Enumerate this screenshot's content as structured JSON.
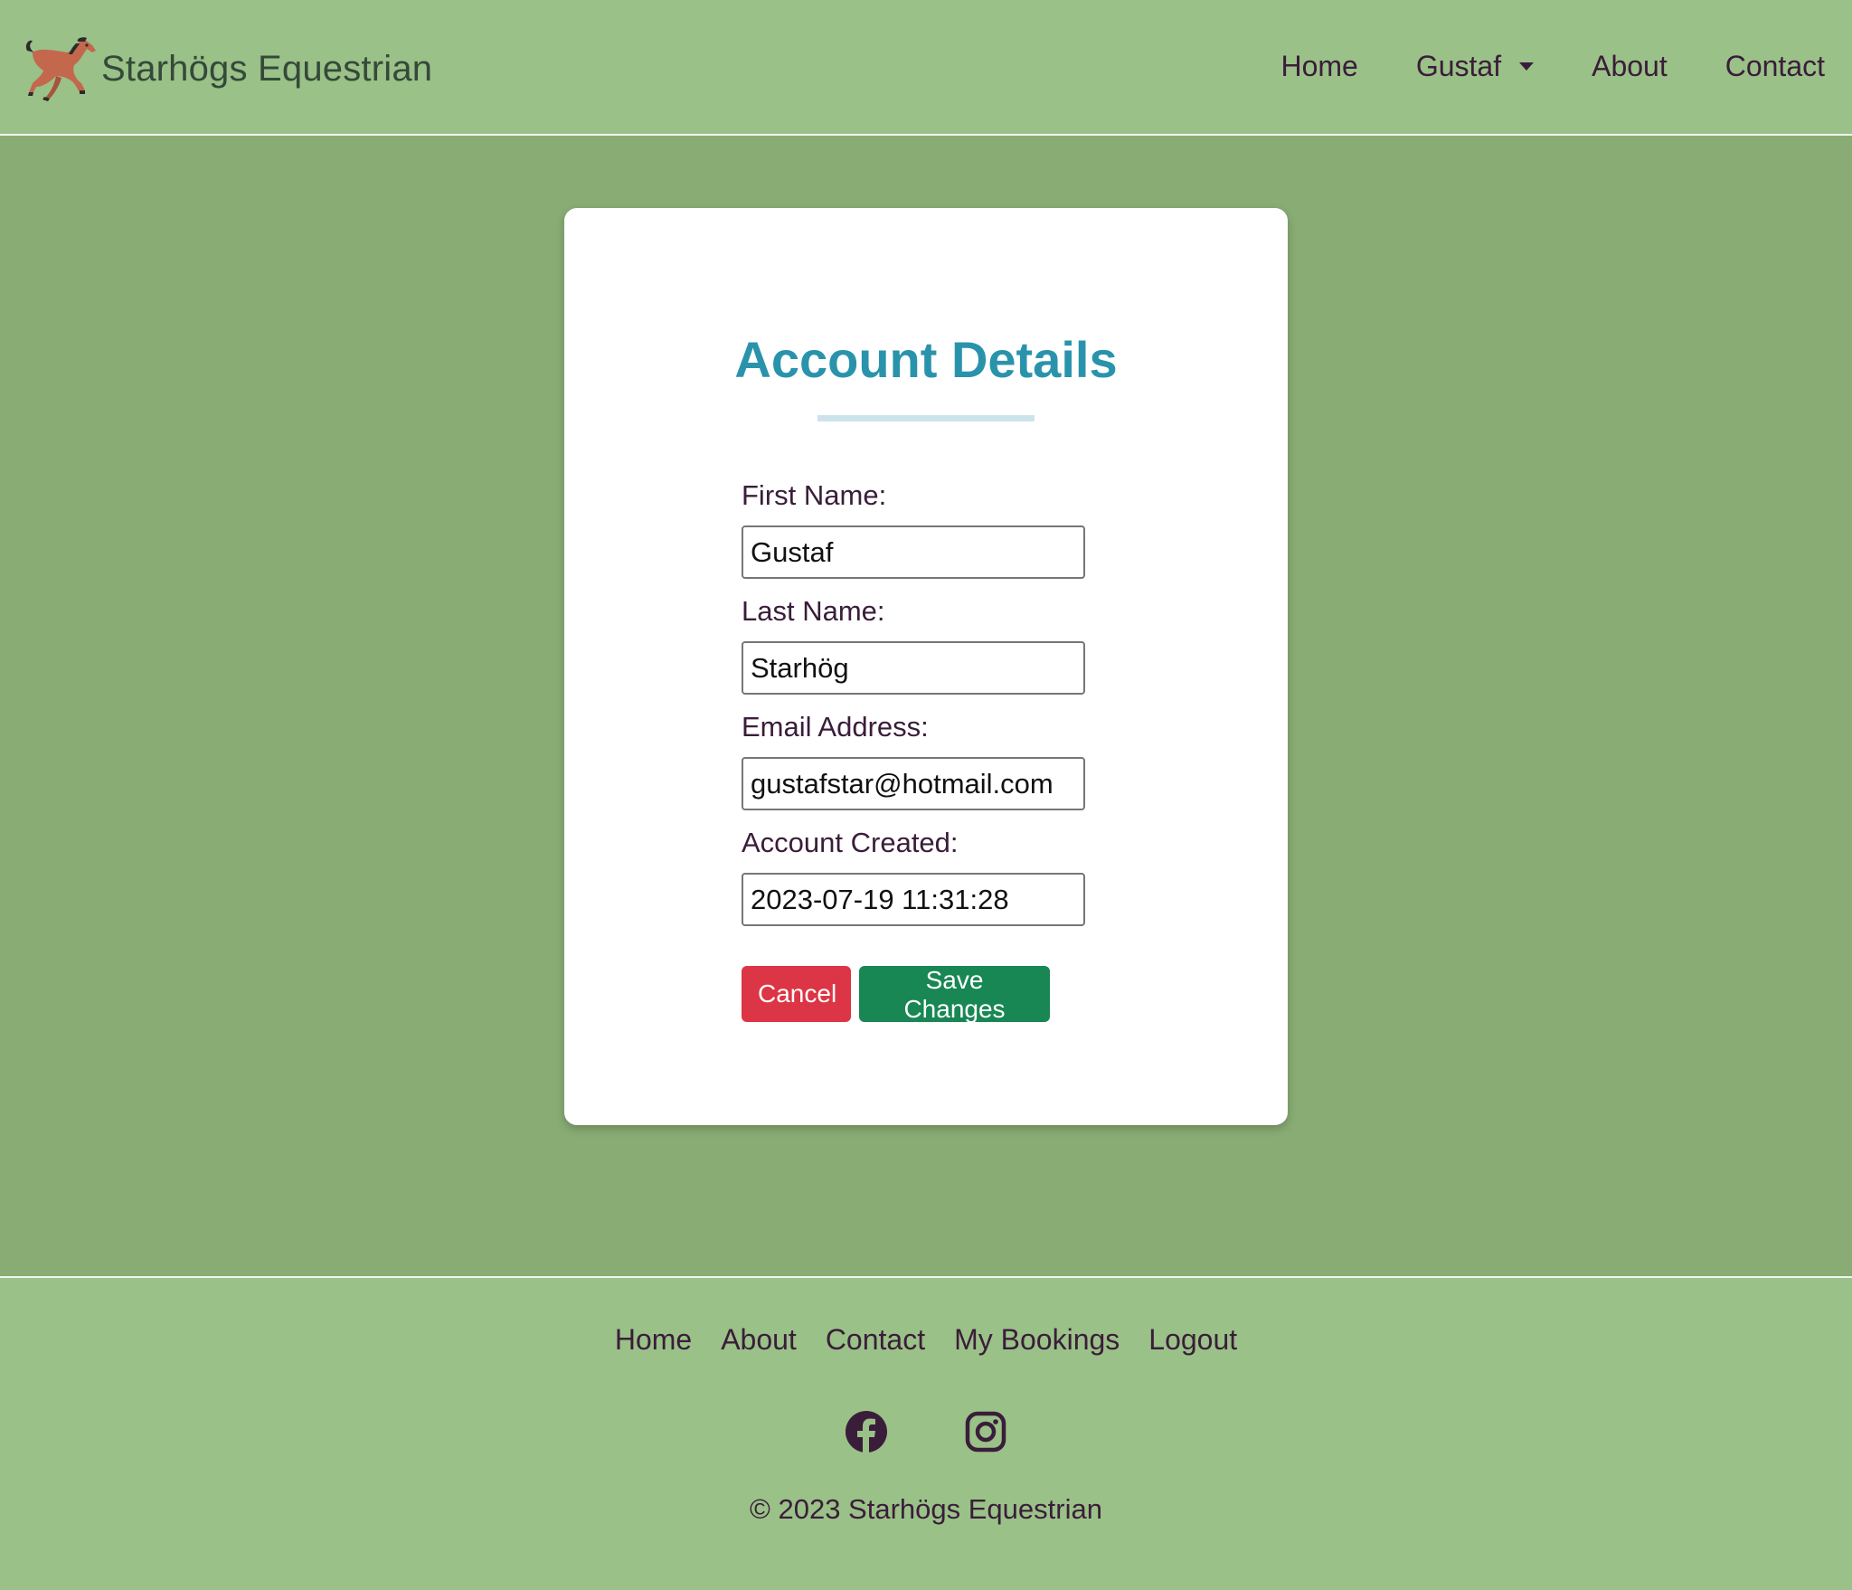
{
  "header": {
    "brand_name": "Starhögs Equestrian",
    "nav": {
      "home": "Home",
      "user_menu": "Gustaf",
      "about": "About",
      "contact": "Contact"
    }
  },
  "card": {
    "title": "Account Details",
    "fields": {
      "first_name": {
        "label": "First Name:",
        "value": "Gustaf"
      },
      "last_name": {
        "label": "Last Name:",
        "value": "Starhög"
      },
      "email": {
        "label": "Email Address:",
        "value": "gustafstar@hotmail.com"
      },
      "created": {
        "label": "Account Created:",
        "value": "2023-07-19 11:31:28"
      }
    },
    "buttons": {
      "cancel": "Cancel",
      "save": "Save Changes"
    }
  },
  "footer": {
    "links": {
      "home": "Home",
      "about": "About",
      "contact": "Contact",
      "bookings": "My Bookings",
      "logout": "Logout"
    },
    "socials": [
      "facebook-icon",
      "instagram-icon"
    ],
    "copyright": "© 2023 Starhögs Equestrian"
  },
  "colors": {
    "header_bg": "#9ac187",
    "page_bg": "#89ac74",
    "title": "#2a93ac",
    "cancel": "#dc3545",
    "save": "#198754",
    "text": "#3a1d3a"
  }
}
